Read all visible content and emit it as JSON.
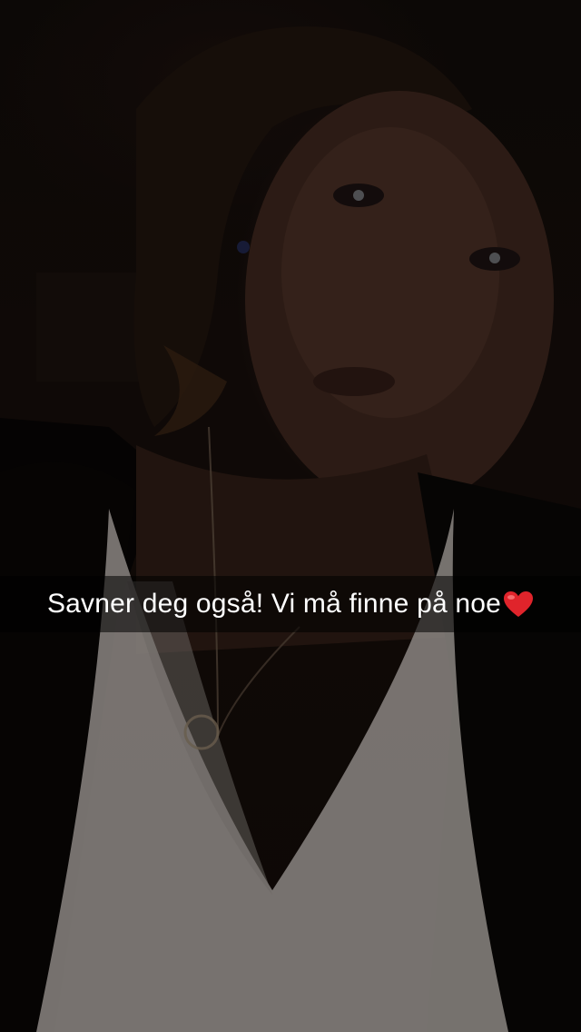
{
  "snap": {
    "caption": {
      "text": "Savner deg også! Vi må finne på noe",
      "emoji": "red-heart-icon",
      "emoji_color": "#e0242b"
    }
  },
  "colors": {
    "caption_background": "rgba(0,0,0,0.55)",
    "caption_text": "#ffffff"
  }
}
